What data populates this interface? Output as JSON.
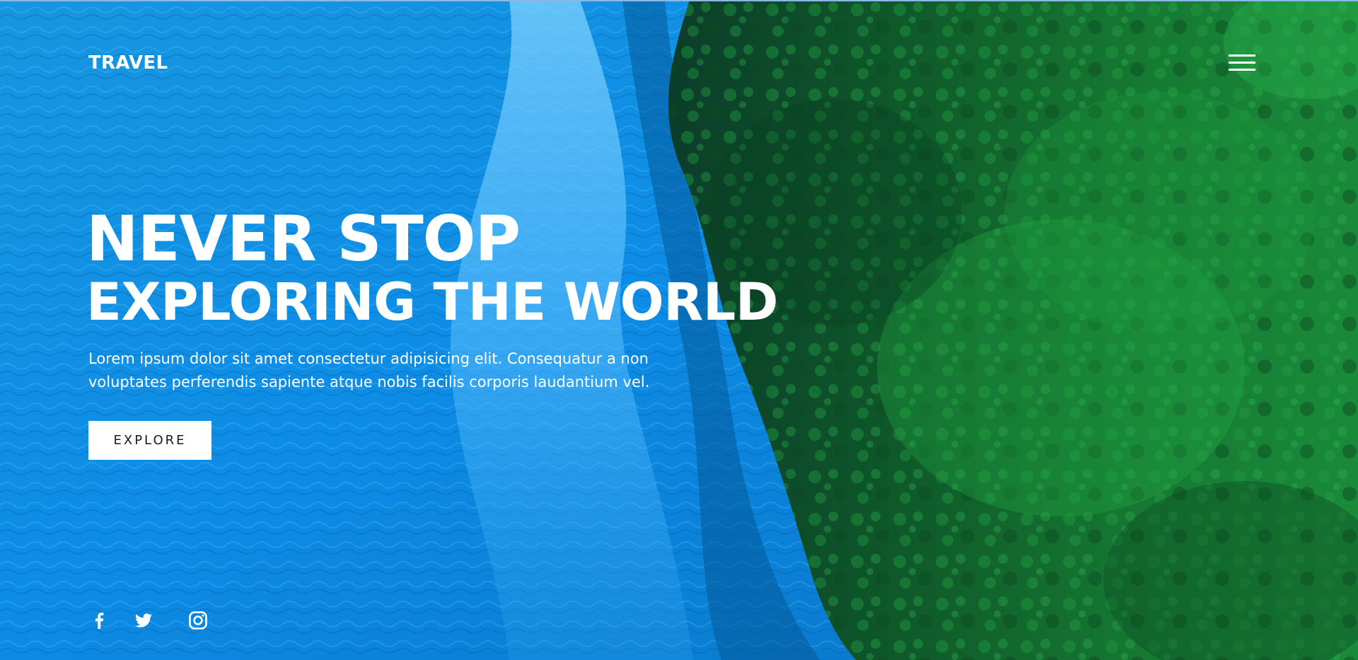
{
  "nav": {
    "brand": "TRAVEL",
    "menu_icon": "hamburger-menu-icon"
  },
  "hero": {
    "headline_line1": "NEVER STOP",
    "headline_line2": "EXPLORING THE WORLD",
    "description": "Lorem ipsum dolor sit amet consectetur adipisicing elit. Consequatur a non voluptates perferendis sapiente atque nobis facilis corporis laudantium vel.",
    "cta_label": "EXPLORE"
  },
  "social": [
    {
      "name": "facebook",
      "icon": "facebook-icon"
    },
    {
      "name": "twitter",
      "icon": "twitter-icon"
    },
    {
      "name": "instagram",
      "icon": "instagram-icon"
    }
  ],
  "colors": {
    "water": "#0c8ee6",
    "forest": "#0f5a22",
    "text": "#ffffff",
    "button_bg": "#ffffff",
    "button_text": "#1b1b1b"
  }
}
